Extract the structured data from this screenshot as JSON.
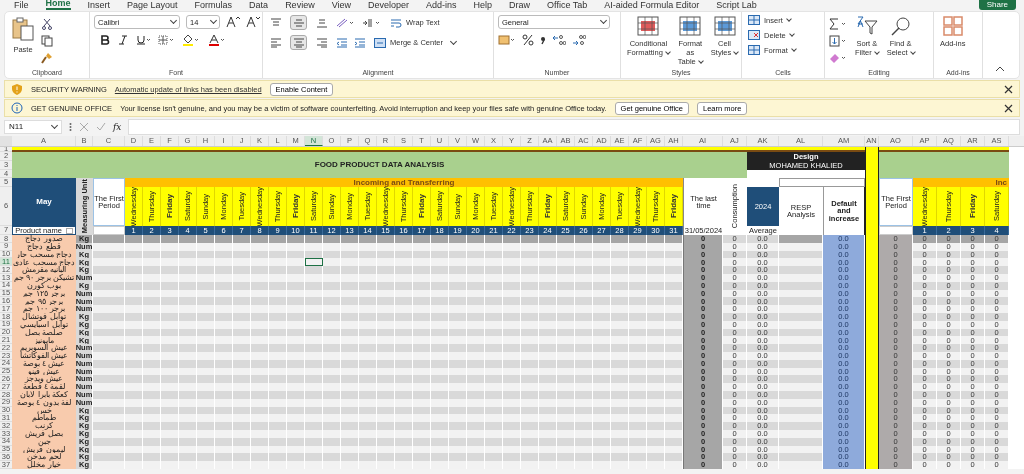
{
  "ribbon_tabs": [
    {
      "label": "File",
      "selected": false
    },
    {
      "label": "Home",
      "selected": true
    },
    {
      "label": "Insert",
      "selected": false
    },
    {
      "label": "Page Layout",
      "selected": false
    },
    {
      "label": "Formulas",
      "selected": false
    },
    {
      "label": "Data",
      "selected": false
    },
    {
      "label": "Review",
      "selected": false
    },
    {
      "label": "View",
      "selected": false
    },
    {
      "label": "Developer",
      "selected": false
    },
    {
      "label": "Add-ins",
      "selected": false
    },
    {
      "label": "Help",
      "selected": false
    },
    {
      "label": "Draw",
      "selected": false
    },
    {
      "label": "Office Tab",
      "selected": false
    },
    {
      "label": "AI-aided Formula Editor",
      "selected": false
    },
    {
      "label": "Script Lab",
      "selected": false
    }
  ],
  "share_button": "Share",
  "clipboard": {
    "paste": "Paste",
    "group": "Clipboard"
  },
  "font": {
    "name": "Calibri",
    "size": "14",
    "group": "Font"
  },
  "alignment": {
    "vertical": [
      {
        "selected": false
      },
      {
        "selected": true
      },
      {
        "selected": false
      }
    ],
    "horizontal": [
      {
        "selected": false
      },
      {
        "selected": true
      },
      {
        "selected": false
      }
    ],
    "wrap_text": "Wrap Text",
    "merge_center": "Merge & Center",
    "group": "Alignment"
  },
  "number": {
    "format": "General",
    "group": "Number"
  },
  "styles": {
    "buttons": [
      {
        "line1": "Conditional",
        "line2": "Formatting"
      },
      {
        "line1": "Format as",
        "line2": "Table"
      },
      {
        "line1": "Cell",
        "line2": "Styles"
      }
    ],
    "group": "Styles"
  },
  "cells": {
    "buttons": [
      "Insert",
      "Delete",
      "Format"
    ],
    "group": "Cells"
  },
  "editing": {
    "sort": {
      "line1": "Sort &",
      "line2": "Filter"
    },
    "find": {
      "line1": "Find &",
      "line2": "Select"
    },
    "group": "Editing"
  },
  "addins": {
    "button": "Add-ins",
    "group": "Add-ins"
  },
  "messages": [
    {
      "kind": "warning",
      "title": "SECURITY WARNING",
      "text": "Automatic update of links has been disabled",
      "link": true,
      "buttons": [
        "Enable Content"
      ]
    },
    {
      "kind": "info",
      "title": "GET GENUINE OFFICE",
      "text": "Your license isn't genuine, and you may be a victim of software counterfeiting. Avoid interruption and keep your files safe with genuine Office today.",
      "link": false,
      "buttons": [
        "Get genuine Office",
        "Learn more"
      ]
    }
  ],
  "formula_bar": {
    "name_box": "N11",
    "fx": "fx"
  },
  "columns": [
    {
      "letter": "A",
      "selected": false
    },
    {
      "letter": "B",
      "selected": false
    },
    {
      "letter": "C",
      "selected": false
    },
    {
      "letter": "D",
      "selected": false
    },
    {
      "letter": "E",
      "selected": false
    },
    {
      "letter": "F",
      "selected": false
    },
    {
      "letter": "G",
      "selected": false
    },
    {
      "letter": "H",
      "selected": false
    },
    {
      "letter": "I",
      "selected": false
    },
    {
      "letter": "J",
      "selected": false
    },
    {
      "letter": "K",
      "selected": false
    },
    {
      "letter": "L",
      "selected": false
    },
    {
      "letter": "M",
      "selected": false
    },
    {
      "letter": "N",
      "selected": true
    },
    {
      "letter": "O",
      "selected": false
    },
    {
      "letter": "P",
      "selected": false
    },
    {
      "letter": "Q",
      "selected": false
    },
    {
      "letter": "R",
      "selected": false
    },
    {
      "letter": "S",
      "selected": false
    },
    {
      "letter": "T",
      "selected": false
    },
    {
      "letter": "U",
      "selected": false
    },
    {
      "letter": "V",
      "selected": false
    },
    {
      "letter": "W",
      "selected": false
    },
    {
      "letter": "X",
      "selected": false
    },
    {
      "letter": "Y",
      "selected": false
    },
    {
      "letter": "Z",
      "selected": false
    },
    {
      "letter": "AA",
      "selected": false
    },
    {
      "letter": "AB",
      "selected": false
    },
    {
      "letter": "AC",
      "selected": false
    },
    {
      "letter": "AD",
      "selected": false
    },
    {
      "letter": "AE",
      "selected": false
    },
    {
      "letter": "AF",
      "selected": false
    },
    {
      "letter": "AG",
      "selected": false
    },
    {
      "letter": "AH",
      "selected": false
    },
    {
      "letter": "AI",
      "selected": false
    },
    {
      "letter": "AJ",
      "selected": false
    },
    {
      "letter": "AK",
      "selected": false
    },
    {
      "letter": "AL",
      "selected": false
    },
    {
      "letter": "AM",
      "selected": false
    },
    {
      "letter": "AN",
      "selected": false
    },
    {
      "letter": "AO",
      "selected": false
    },
    {
      "letter": "AP",
      "selected": false
    },
    {
      "letter": "AQ",
      "selected": false
    },
    {
      "letter": "AR",
      "selected": false
    },
    {
      "letter": "AS",
      "selected": false
    }
  ],
  "header_rows": [
    "1",
    "2",
    "3",
    "4",
    "5",
    "6",
    "7"
  ],
  "sheet_header": {
    "title": "FOOD PRODUCT DATA ANALYSIS",
    "design_label": "Design",
    "designer": "MOHAMED KHALIED",
    "month": "May",
    "unit_header": "Measuring Unit",
    "first_period": "The First Period",
    "incoming": "Incoming and Transferring",
    "product_name": "Product name",
    "last_time": "The last time",
    "last_date": "31/05/2024",
    "consumption": "Consumption",
    "year": "2024",
    "average": "Average",
    "resp": "RESP Analysis",
    "default_increase": "Default and increase",
    "first_period_2": "The First Period",
    "incoming_2": "Inc"
  },
  "days": [
    {
      "name": "Wednesday",
      "number": "1",
      "bold": false
    },
    {
      "name": "Thursday",
      "number": "2",
      "bold": false
    },
    {
      "name": "Friday",
      "number": "3",
      "bold": true
    },
    {
      "name": "Saturday",
      "number": "4",
      "bold": false
    },
    {
      "name": "Sunday",
      "number": "5",
      "bold": false
    },
    {
      "name": "Monday",
      "number": "6",
      "bold": false
    },
    {
      "name": "Tuesday",
      "number": "7",
      "bold": false
    },
    {
      "name": "Wednesday",
      "number": "8",
      "bold": false
    },
    {
      "name": "Thursday",
      "number": "9",
      "bold": false
    },
    {
      "name": "Friday",
      "number": "10",
      "bold": true
    },
    {
      "name": "Saturday",
      "number": "11",
      "bold": false
    },
    {
      "name": "Sunday",
      "number": "12",
      "bold": false
    },
    {
      "name": "Monday",
      "number": "13",
      "bold": false
    },
    {
      "name": "Tuesday",
      "number": "14",
      "bold": false
    },
    {
      "name": "Wednesday",
      "number": "15",
      "bold": false
    },
    {
      "name": "Thursday",
      "number": "16",
      "bold": false
    },
    {
      "name": "Friday",
      "number": "17",
      "bold": true
    },
    {
      "name": "Saturday",
      "number": "18",
      "bold": false
    },
    {
      "name": "Sunday",
      "number": "19",
      "bold": false
    },
    {
      "name": "Monday",
      "number": "20",
      "bold": false
    },
    {
      "name": "Tuesday",
      "number": "21",
      "bold": false
    },
    {
      "name": "Wednesday",
      "number": "22",
      "bold": false
    },
    {
      "name": "Thursday",
      "number": "23",
      "bold": false
    },
    {
      "name": "Friday",
      "number": "24",
      "bold": true
    },
    {
      "name": "Saturday",
      "number": "25",
      "bold": false
    },
    {
      "name": "Sunday",
      "number": "26",
      "bold": false
    },
    {
      "name": "Monday",
      "number": "27",
      "bold": false
    },
    {
      "name": "Tuesday",
      "number": "28",
      "bold": false
    },
    {
      "name": "Wednesday",
      "number": "29",
      "bold": false
    },
    {
      "name": "Thursday",
      "number": "30",
      "bold": false
    },
    {
      "name": "Friday",
      "number": "31",
      "bold": true
    }
  ],
  "days_2": [
    {
      "name": "Wednesday",
      "number": "1",
      "bold": false
    },
    {
      "name": "Thursday",
      "number": "2",
      "bold": false
    },
    {
      "name": "Friday",
      "number": "3",
      "bold": true
    },
    {
      "name": "Saturday",
      "number": "4",
      "bold": false
    }
  ],
  "rows": [
    {
      "row": "8",
      "name": "صدور دجاج",
      "unit": "Kg",
      "dark": true,
      "selected": false,
      "last_time": "0",
      "consumption": "0",
      "average": "0.0",
      "default_increase": "0.0",
      "first_period": "0",
      "next": [
        "0",
        "0",
        "0",
        "0"
      ]
    },
    {
      "row": "9",
      "name": "قطع دجاج",
      "unit": "Num",
      "dark": false,
      "selected": false,
      "last_time": "0",
      "consumption": "0",
      "average": "0.0",
      "default_increase": "0.0",
      "first_period": "0",
      "next": [
        "0",
        "0",
        "0",
        "0"
      ]
    },
    {
      "row": "10",
      "name": "دجاج مسحب حار",
      "unit": "Kg",
      "dark": false,
      "selected": false,
      "last_time": "0",
      "consumption": "0",
      "average": "0.0",
      "default_increase": "0.0",
      "first_period": "0",
      "next": [
        "0",
        "0",
        "0",
        "0"
      ]
    },
    {
      "row": "11",
      "name": "دجاج مسحب عادي",
      "unit": "Kg",
      "dark": false,
      "selected": true,
      "last_time": "0",
      "consumption": "0",
      "average": "0.0",
      "default_increase": "0.0",
      "first_period": "0",
      "next": [
        "0",
        "0",
        "0",
        "0"
      ]
    },
    {
      "row": "12",
      "name": "البانيه مقرمش",
      "unit": "Kg",
      "dark": false,
      "selected": false,
      "last_time": "0",
      "consumption": "0",
      "average": "0.0",
      "default_increase": "0.0",
      "first_period": "0",
      "next": [
        "0",
        "0",
        "0",
        "0"
      ]
    },
    {
      "row": "13",
      "name": "تشيكن برجر ٩٠ جم",
      "unit": "Num",
      "dark": false,
      "selected": false,
      "last_time": "0",
      "consumption": "0",
      "average": "0.0",
      "default_increase": "0.0",
      "first_period": "0",
      "next": [
        "0",
        "0",
        "0",
        "0"
      ]
    },
    {
      "row": "14",
      "name": "بوب كورن",
      "unit": "Kg",
      "dark": false,
      "selected": false,
      "last_time": "0",
      "consumption": "0",
      "average": "0.0",
      "default_increase": "0.0",
      "first_period": "0",
      "next": [
        "0",
        "0",
        "0",
        "0"
      ]
    },
    {
      "row": "15",
      "name": "برجر ١٢٥ جم",
      "unit": "Num",
      "dark": false,
      "selected": false,
      "last_time": "0",
      "consumption": "0",
      "average": "0.0",
      "default_increase": "0.0",
      "first_period": "0",
      "next": [
        "0",
        "0",
        "0",
        "0"
      ]
    },
    {
      "row": "16",
      "name": "برجر ٩٥ جم",
      "unit": "Num",
      "dark": false,
      "selected": false,
      "last_time": "0",
      "consumption": "0",
      "average": "0.0",
      "default_increase": "0.0",
      "first_period": "0",
      "next": [
        "0",
        "0",
        "0",
        "0"
      ]
    },
    {
      "row": "17",
      "name": "برجر ١٠٠ جم",
      "unit": "Num",
      "dark": false,
      "selected": false,
      "last_time": "0",
      "consumption": "0",
      "average": "0.0",
      "default_increase": "0.0",
      "first_period": "0",
      "next": [
        "0",
        "0",
        "0",
        "0"
      ]
    },
    {
      "row": "18",
      "name": "توابل فوتشال",
      "unit": "Kg",
      "dark": false,
      "selected": false,
      "last_time": "0",
      "consumption": "0",
      "average": "0.0",
      "default_increase": "0.0",
      "first_period": "0",
      "next": [
        "0",
        "0",
        "0",
        "0"
      ]
    },
    {
      "row": "19",
      "name": "توابل اسبايسي",
      "unit": "Kg",
      "dark": false,
      "selected": false,
      "last_time": "0",
      "consumption": "0",
      "average": "0.0",
      "default_increase": "0.0",
      "first_period": "0",
      "next": [
        "0",
        "0",
        "0",
        "0"
      ]
    },
    {
      "row": "20",
      "name": "صلصة بصل",
      "unit": "Kg",
      "dark": false,
      "selected": false,
      "last_time": "0",
      "consumption": "0",
      "average": "0.0",
      "default_increase": "0.0",
      "first_period": "0",
      "next": [
        "0",
        "0",
        "0",
        "0"
      ]
    },
    {
      "row": "21",
      "name": "مايونيز",
      "unit": "Kg",
      "dark": false,
      "selected": false,
      "last_time": "0",
      "consumption": "0",
      "average": "0.0",
      "default_increase": "0.0",
      "first_period": "0",
      "next": [
        "0",
        "0",
        "0",
        "0"
      ]
    },
    {
      "row": "22",
      "name": "عيش السوبريم",
      "unit": "Num",
      "dark": false,
      "selected": false,
      "last_time": "0",
      "consumption": "0",
      "average": "0.0",
      "default_increase": "0.0",
      "first_period": "0",
      "next": [
        "0",
        "0",
        "0",
        "0"
      ]
    },
    {
      "row": "23",
      "name": "عيش الفوكاتشا",
      "unit": "Num",
      "dark": false,
      "selected": false,
      "last_time": "0",
      "consumption": "0",
      "average": "0.0",
      "default_increase": "0.0",
      "first_period": "0",
      "next": [
        "0",
        "0",
        "0",
        "0"
      ]
    },
    {
      "row": "24",
      "name": "عيش ٤ بوصة",
      "unit": "Num",
      "dark": false,
      "selected": false,
      "last_time": "0",
      "consumption": "0",
      "average": "0.0",
      "default_increase": "0.0",
      "first_period": "0",
      "next": [
        "0",
        "0",
        "0",
        "0"
      ]
    },
    {
      "row": "25",
      "name": "عيش فينو",
      "unit": "Num",
      "dark": false,
      "selected": false,
      "last_time": "0",
      "consumption": "0",
      "average": "0.0",
      "default_increase": "0.0",
      "first_period": "0",
      "next": [
        "0",
        "0",
        "0",
        "0"
      ]
    },
    {
      "row": "26",
      "name": "عيش ويدجز",
      "unit": "Num",
      "dark": false,
      "selected": false,
      "last_time": "0",
      "consumption": "0",
      "average": "0.0",
      "default_increase": "0.0",
      "first_period": "0",
      "next": [
        "0",
        "0",
        "0",
        "0"
      ]
    },
    {
      "row": "27",
      "name": "لقمة ٤ قطعة",
      "unit": "Num",
      "dark": false,
      "selected": false,
      "last_time": "0",
      "consumption": "0",
      "average": "0.0",
      "default_increase": "0.0",
      "first_period": "0",
      "next": [
        "0",
        "0",
        "0",
        "0"
      ]
    },
    {
      "row": "28",
      "name": "كعكة بابرا لابان",
      "unit": "Num",
      "dark": false,
      "selected": false,
      "last_time": "0",
      "consumption": "0",
      "average": "0.0",
      "default_increase": "0.0",
      "first_period": "0",
      "next": [
        "0",
        "0",
        "0",
        "0"
      ]
    },
    {
      "row": "29",
      "name": "لفة بدون ٤ بوصة",
      "unit": "Num",
      "dark": false,
      "selected": false,
      "last_time": "0",
      "consumption": "0",
      "average": "0.0",
      "default_increase": "0.0",
      "first_period": "0",
      "next": [
        "0",
        "0",
        "0",
        "0"
      ]
    },
    {
      "row": "30",
      "name": "خس",
      "unit": "Kg",
      "dark": false,
      "selected": false,
      "last_time": "0",
      "consumption": "0",
      "average": "0.0",
      "default_increase": "0.0",
      "first_period": "0",
      "next": [
        "0",
        "0",
        "0",
        "0"
      ]
    },
    {
      "row": "31",
      "name": "طماطم",
      "unit": "Kg",
      "dark": false,
      "selected": false,
      "last_time": "0",
      "consumption": "0",
      "average": "0.0",
      "default_increase": "0.0",
      "first_period": "0",
      "next": [
        "0",
        "0",
        "0",
        "0"
      ]
    },
    {
      "row": "32",
      "name": "كرنب",
      "unit": "Kg",
      "dark": false,
      "selected": false,
      "last_time": "0",
      "consumption": "0",
      "average": "0.0",
      "default_increase": "0.0",
      "first_period": "0",
      "next": [
        "0",
        "0",
        "0",
        "0"
      ]
    },
    {
      "row": "33",
      "name": "بصل فريش",
      "unit": "Kg",
      "dark": false,
      "selected": false,
      "last_time": "0",
      "consumption": "0",
      "average": "0.0",
      "default_increase": "0.0",
      "first_period": "0",
      "next": [
        "0",
        "0",
        "0",
        "0"
      ]
    },
    {
      "row": "34",
      "name": "جبن",
      "unit": "Kg",
      "dark": false,
      "selected": false,
      "last_time": "0",
      "consumption": "0",
      "average": "0.0",
      "default_increase": "0.0",
      "first_period": "0",
      "next": [
        "0",
        "0",
        "0",
        "0"
      ]
    },
    {
      "row": "35",
      "name": "ليمون فريش",
      "unit": "Kg",
      "dark": false,
      "selected": false,
      "last_time": "0",
      "consumption": "0",
      "average": "0.0",
      "default_increase": "0.0",
      "first_period": "0",
      "next": [
        "0",
        "0",
        "0",
        "0"
      ]
    },
    {
      "row": "36",
      "name": "لحم مدخن",
      "unit": "Kg",
      "dark": false,
      "selected": false,
      "last_time": "0",
      "consumption": "0",
      "average": "0.0",
      "default_increase": "0.0",
      "first_period": "0",
      "next": [
        "0",
        "0",
        "0",
        "0"
      ]
    },
    {
      "row": "37",
      "name": "خيار مخلل",
      "unit": "Kg",
      "dark": false,
      "selected": false,
      "last_time": "0",
      "consumption": "0",
      "average": "0.0",
      "default_increase": "0.0",
      "first_period": "0",
      "next": [
        "0",
        "0",
        "0",
        "0"
      ]
    }
  ]
}
